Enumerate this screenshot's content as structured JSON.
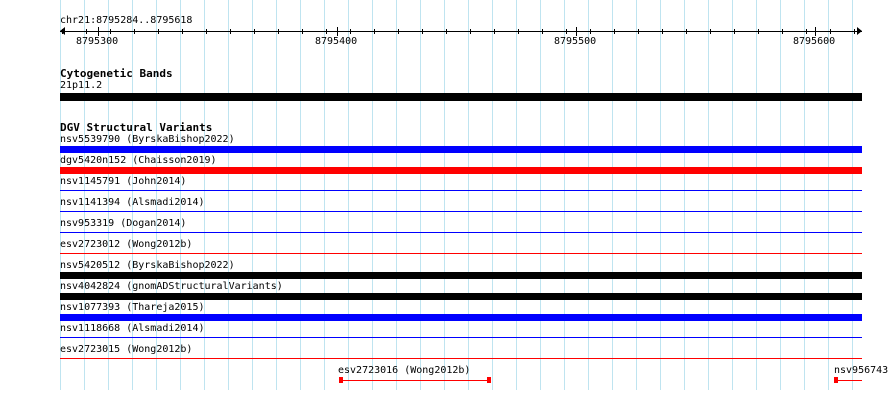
{
  "ruler": {
    "position": "chr21:8795284..8795618",
    "ticks": [
      "8795300",
      "8795400",
      "8795500",
      "8795600"
    ]
  },
  "cytobands": {
    "title": "Cytogenetic Bands",
    "band": "21p11.2"
  },
  "dgv": {
    "title": "DGV Structural Variants",
    "features": [
      {
        "label": "nsv5539790 (ByrskaBishop2022)",
        "color": "#0000ff",
        "style": "thick"
      },
      {
        "label": "dgv5420n152 (Chaisson2019)",
        "color": "#ff0000",
        "style": "thick"
      },
      {
        "label": "nsv1145791 (John2014)",
        "color": "#0000ff",
        "style": "thin"
      },
      {
        "label": "nsv1141394 (Alsmadi2014)",
        "color": "#0000ff",
        "style": "thin"
      },
      {
        "label": "nsv953319 (Dogan2014)",
        "color": "#0000ff",
        "style": "thin"
      },
      {
        "label": "esv2723012 (Wong2012b)",
        "color": "#ff0000",
        "style": "thin"
      },
      {
        "label": "nsv5420512 (ByrskaBishop2022)",
        "color": "#000000",
        "style": "thick"
      },
      {
        "label": "nsv4042824 (gnomADStructuralVariants)",
        "color": "#000000",
        "style": "thick"
      },
      {
        "label": "nsv1077393 (Thareja2015)",
        "color": "#0000ff",
        "style": "thick"
      },
      {
        "label": "nsv1118668 (Alsmadi2014)",
        "color": "#0000ff",
        "style": "thin"
      },
      {
        "label": "esv2723015 (Wong2012b)",
        "color": "#ff0000",
        "style": "thin"
      }
    ],
    "short_features": [
      {
        "label": "esv2723016 (Wong2012b)",
        "color": "#ff0000"
      },
      {
        "label": "nsv956743",
        "color": "#ff0000"
      }
    ]
  }
}
